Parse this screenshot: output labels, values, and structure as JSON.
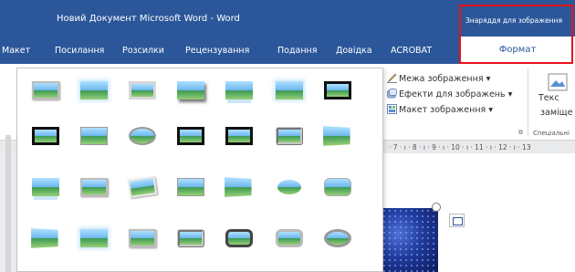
{
  "window": {
    "title": "Новий Документ Microsoft Word  -  Word",
    "context_title": "Знаряддя для зображення"
  },
  "tabs": [
    "Макет",
    "Посилання",
    "Розсилки",
    "Рецензування",
    "Подання",
    "Довідка",
    "ACROBAT"
  ],
  "format_tab": "Формат",
  "ribbon": {
    "picture_border": "Межа зображення",
    "picture_effects": "Ефекти для зображень",
    "picture_layout": "Макет зображення",
    "text_btn_line1": "Текс",
    "text_btn_line2": "заміще",
    "group_label": "Спеціальні",
    "launcher": "⧉",
    "ruler": "· 7 · ı · 8 · ı · 9 · ı · 10 · ı · 11 · ı · 12 · ı · 13"
  },
  "gallery": {
    "styles": [
      "simple-frame-white",
      "soft-edge-rectangle",
      "thick-matte-gray",
      "drop-shadow-rectangle",
      "reflected-rounded",
      "soft-edge",
      "black-frame",
      "metal-frame-black",
      "simple-frame-black",
      "oval-metal",
      "center-shadow",
      "black-double-frame",
      "beveled-matte",
      "perspective-shadow",
      "reflected-bevel",
      "simple-white-frame",
      "rotated-white",
      "moderate-frame",
      "relaxed-perspective",
      "soft-oval",
      "rounded-diagonal",
      "snip-diagonal",
      "rounded-frame",
      "bevel-perspective",
      "metal-rounded",
      "compound-frame",
      "metal-oval",
      "oval-soft"
    ]
  },
  "colors": {
    "title_bar": "#2b579a",
    "context_highlight": "#e8121b"
  }
}
